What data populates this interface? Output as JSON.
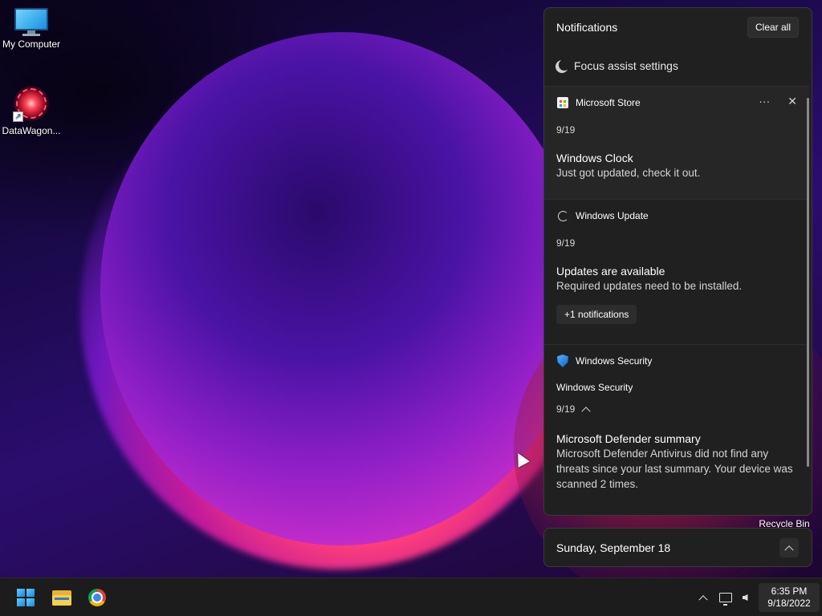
{
  "desktop": {
    "icons": [
      {
        "label": "My Computer",
        "icon": "monitor-icon"
      },
      {
        "label": "DataWagon...",
        "icon": "flower-shortcut-icon"
      }
    ],
    "recycle_bin_label": "Recycle Bin"
  },
  "notifications": {
    "title": "Notifications",
    "clear_all": "Clear all",
    "focus_assist": "Focus assist settings",
    "more_glyph": "···",
    "close_glyph": "✕",
    "items": [
      {
        "app": "Microsoft Store",
        "icon": "store-icon",
        "date": "9/19",
        "title": "Windows Clock",
        "body": "Just got updated, check it out."
      },
      {
        "app": "Windows Update",
        "icon": "refresh-icon",
        "date": "9/19",
        "title": "Updates are available",
        "body": "Required updates need to be installed.",
        "more": "+1 notifications"
      },
      {
        "app": "Windows Security",
        "icon": "shield-icon",
        "group_title": "Windows Security",
        "date": "9/19",
        "title": "Microsoft Defender summary",
        "body": "Microsoft Defender Antivirus did not find any threats since your last summary. Your device was scanned 2 times."
      }
    ]
  },
  "calendar": {
    "date_label": "Sunday, September 18"
  },
  "taskbar": {
    "apps": [
      "start-icon",
      "file-explorer-icon",
      "chrome-icon"
    ],
    "tray_icons": [
      "chevron-up-icon",
      "network-icon",
      "volume-icon"
    ],
    "time": "6:35 PM",
    "date": "9/18/2022"
  },
  "colors": {
    "panel_bg": "#202020",
    "taskbar_bg": "#1c1c1c",
    "accent": "#1a86e0"
  }
}
